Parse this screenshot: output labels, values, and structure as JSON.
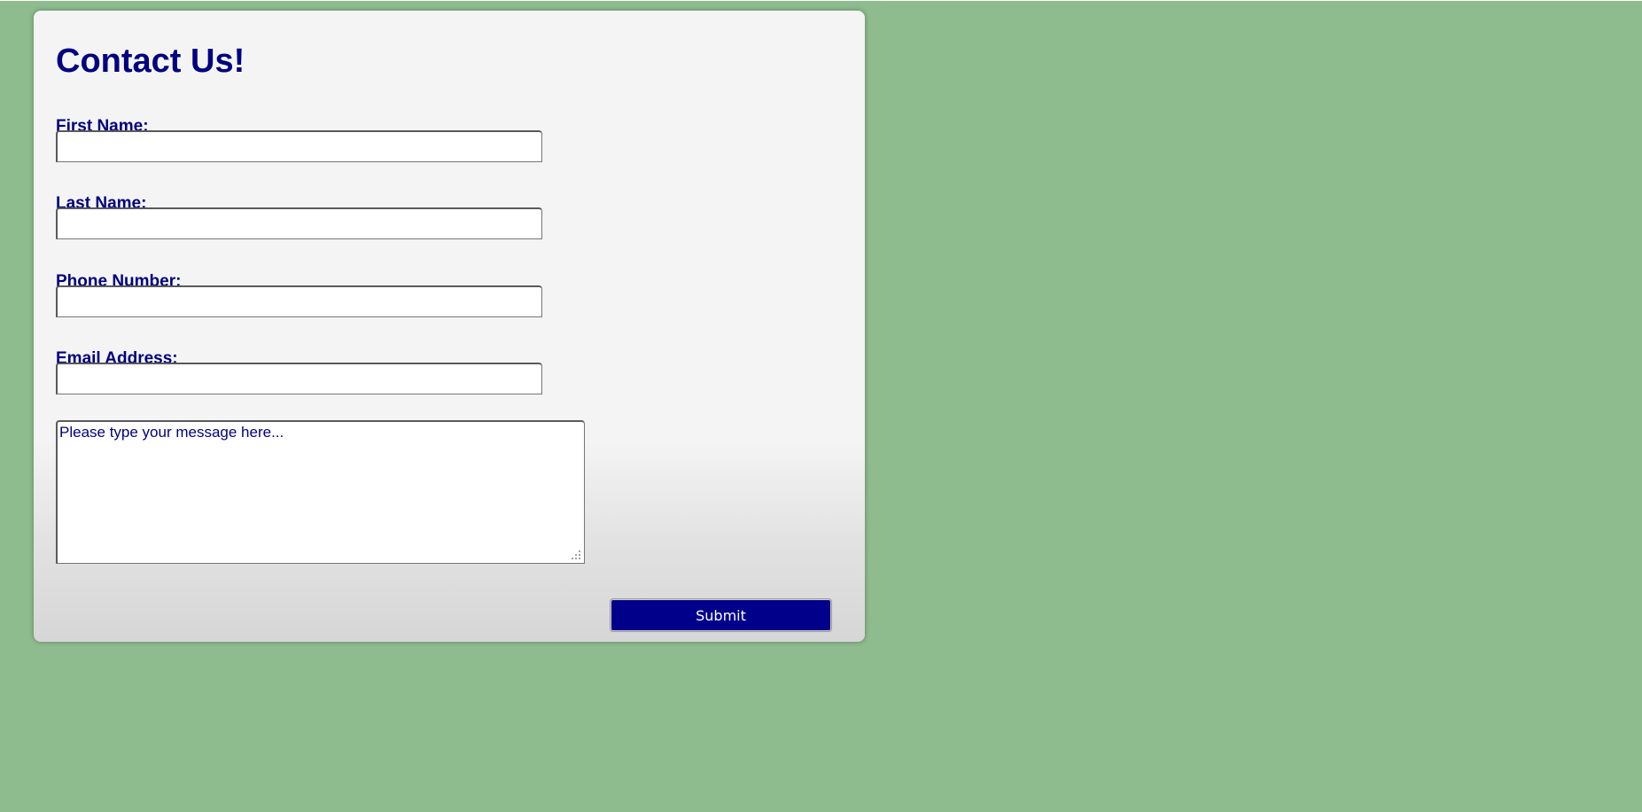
{
  "page": {
    "background_color": "#8fbc8f",
    "accent_color": "#000080"
  },
  "form": {
    "title": "Contact Us!",
    "fields": [
      {
        "label": "First Name:",
        "value": "",
        "placeholder": ""
      },
      {
        "label": "Last Name:",
        "value": "",
        "placeholder": ""
      },
      {
        "label": "Phone Number:",
        "value": "",
        "placeholder": ""
      },
      {
        "label": "Email Address:",
        "value": "",
        "placeholder": ""
      }
    ],
    "message": {
      "value": "",
      "placeholder": "Please type your message here..."
    },
    "submit_label": "Submit",
    "submit_color": "#00008b"
  }
}
